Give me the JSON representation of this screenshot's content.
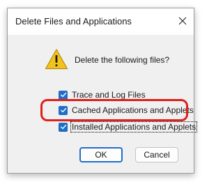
{
  "window": {
    "title": "Delete Files and Applications"
  },
  "prompt": "Delete the following files?",
  "options": [
    {
      "label": "Trace and Log Files",
      "checked": true
    },
    {
      "label": "Cached Applications and Applets",
      "checked": true
    },
    {
      "label": "Installed Applications and Applets",
      "checked": true,
      "focused": true
    }
  ],
  "buttons": {
    "ok": "OK",
    "cancel": "Cancel"
  },
  "colors": {
    "accent": "#1f6fc8",
    "highlight": "#e0201b",
    "warning": "#f2c31b"
  },
  "icons": {
    "warning": "warning-icon",
    "close": "close-icon",
    "check": "check-icon"
  }
}
